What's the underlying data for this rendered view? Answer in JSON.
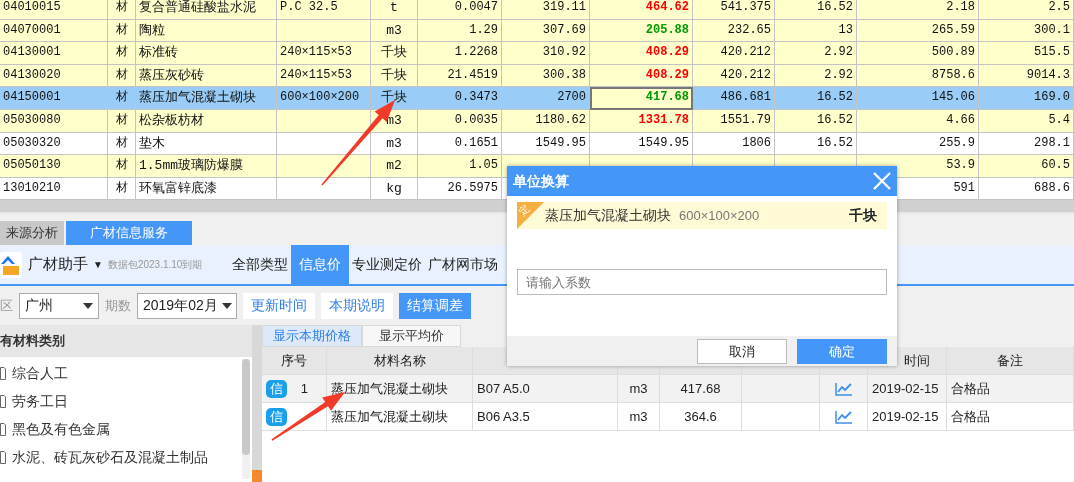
{
  "grid": {
    "rows": [
      {
        "cells": [
          "04010015",
          "材",
          "复合普通硅酸盐水泥",
          "P.C 32.5",
          "t",
          "0.0047",
          "319.11",
          "464.62",
          "541.375",
          "16.52",
          "2.18",
          "2.5"
        ],
        "color": "#ff0000",
        "price_bold": true,
        "highlighted": true,
        "selected": false
      },
      {
        "cells": [
          "04070001",
          "材",
          "陶粒",
          null,
          "m3",
          "1.29",
          "307.69",
          "205.88",
          "232.65",
          "13",
          "265.59",
          "300.1"
        ],
        "color": "#009900",
        "price_bold": true,
        "highlighted": true,
        "selected": false
      },
      {
        "cells": [
          "04130001",
          "材",
          "标准砖",
          "240×115×53",
          "千块",
          "1.2268",
          "310.92",
          "408.29",
          "420.212",
          "2.92",
          "500.89",
          "515.5"
        ],
        "color": "#ff0000",
        "price_bold": true,
        "highlighted": true,
        "selected": false
      },
      {
        "cells": [
          "04130020",
          "材",
          "蒸压灰砂砖",
          "240×115×53",
          "千块",
          "21.4519",
          "300.38",
          "408.29",
          "420.212",
          "2.92",
          "8758.6",
          "9014.3"
        ],
        "color": "#ff0000",
        "price_bold": true,
        "highlighted": true,
        "selected": false
      },
      {
        "cells": [
          "04150001",
          "材",
          "蒸压加气混凝土砌块",
          "600×100×200",
          "千块",
          "0.3473",
          "2700",
          "417.68",
          "486.681",
          "16.52",
          "145.06",
          "169.0"
        ],
        "color": "#009900",
        "price_bold": true,
        "highlighted": true,
        "selected": true
      },
      {
        "cells": [
          "05030080",
          "材",
          "松杂板枋材",
          null,
          "m3",
          "0.0035",
          "1180.62",
          "1331.78",
          "1551.79",
          "16.52",
          "4.66",
          "5.4"
        ],
        "color": "#ff0000",
        "price_bold": true,
        "highlighted": true,
        "selected": false
      },
      {
        "cells": [
          "05030320",
          "材",
          "垫木",
          null,
          "m3",
          "0.1651",
          "1549.95",
          "1549.95",
          "1806",
          "16.52",
          "255.9",
          "298.1"
        ],
        "color": "#111111",
        "price_bold": false,
        "highlighted": false,
        "selected": false
      },
      {
        "cells": [
          "05050130",
          "材",
          "1.5mm玻璃防爆膜",
          null,
          "m2",
          "1.05",
          null,
          null,
          null,
          null,
          "53.9",
          "60.5"
        ],
        "highlighted": true,
        "selected": false
      },
      {
        "cells": [
          "13010210",
          "材",
          "环氧富锌底漆",
          null,
          "kg",
          "26.5975",
          null,
          null,
          null,
          null,
          "591",
          "688.6"
        ],
        "highlighted": false,
        "selected": false
      }
    ]
  },
  "tabs": [
    {
      "label": "来源分析",
      "selected": false
    },
    {
      "label": "广材信息服务",
      "selected": true
    }
  ],
  "toolbar": {
    "title": "广材助手",
    "caret": "▼",
    "expiry": "数据包2023.1.10到期",
    "nav": [
      {
        "label": "全部类型",
        "selected": false
      },
      {
        "label": "信息价",
        "selected": true
      },
      {
        "label": "专业测定价",
        "selected": false
      },
      {
        "label": "广材网市场",
        "selected": false
      }
    ]
  },
  "filters": {
    "region": {
      "label": "区",
      "value": "广州"
    },
    "period": {
      "label": "期数",
      "value": "2019年02月"
    },
    "buttons": [
      {
        "label": "更新时间",
        "primary": false
      },
      {
        "label": "本期说明",
        "primary": false
      },
      {
        "label": "结算调差",
        "primary": true
      }
    ]
  },
  "categories": {
    "title": "有材料类别",
    "items": [
      {
        "label": "综合人工"
      },
      {
        "label": "劳务工日"
      },
      {
        "label": "黑色及有色金属"
      },
      {
        "label": "水泥、砖瓦灰砂石及混凝土制品"
      }
    ]
  },
  "price_tabs": [
    {
      "label": "显示本期价格",
      "selected": true
    },
    {
      "label": "显示平均价",
      "selected": false
    }
  ],
  "price_table": {
    "columns": [
      {
        "title": "序号",
        "kind": "index"
      },
      {
        "title": "材料名称",
        "kind": "text"
      },
      {
        "kind": "text"
      },
      {
        "kind": "center"
      },
      {
        "kind": "center"
      },
      {
        "kind": "center"
      },
      {
        "kind": "trend"
      },
      {
        "title": "时间",
        "kind": "late"
      },
      {
        "title": "备注",
        "kind": "text"
      }
    ],
    "rows": [
      {
        "badge": "信",
        "cells": [
          "1",
          "蒸压加气混凝土砌块",
          "B07 A5.0",
          "m3",
          "417.68",
          null,
          null,
          "2019-02-15",
          "合格品"
        ],
        "selected": true
      },
      {
        "badge": "信",
        "cells": [
          null,
          "蒸压加气混凝土砌块",
          "B06 A3.5",
          "m3",
          "364.6",
          null,
          null,
          "2019-02-15",
          "合格品"
        ],
        "selected": false
      }
    ]
  },
  "dialog": {
    "title": "单位换算",
    "tag": "定",
    "material": "蒸压加气混凝土砌块",
    "spec": "600×100×200",
    "unit": "千块",
    "input": {
      "placeholder": "请输入系数"
    },
    "buttons": [
      {
        "label": "取消",
        "kind": "secondary"
      },
      {
        "label": "确定",
        "kind": "primary"
      }
    ]
  }
}
